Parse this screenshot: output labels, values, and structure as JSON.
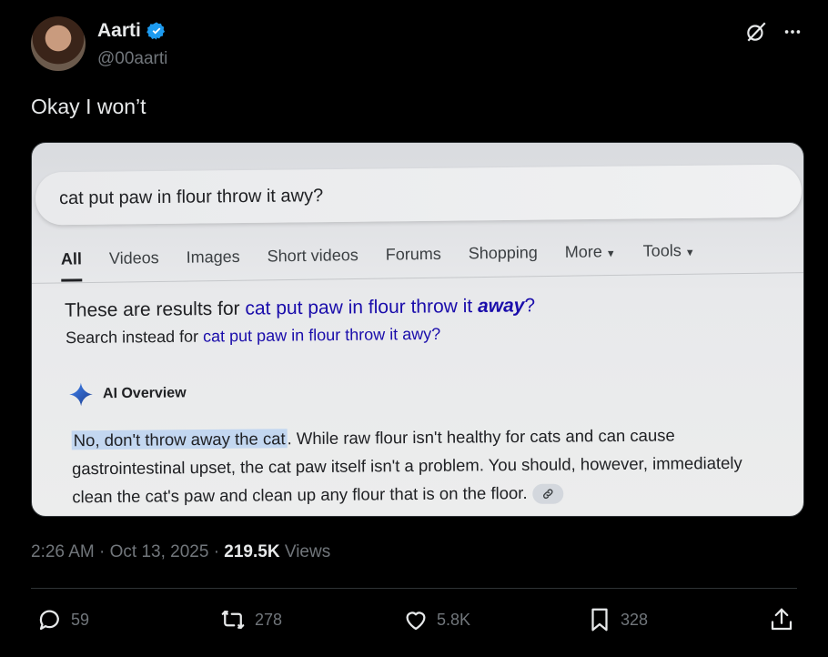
{
  "author": {
    "display_name": "Aarti",
    "handle": "@00aarti"
  },
  "icons": {
    "verified": "verified-badge-icon",
    "grok": "grok-icon",
    "more": "more-options-icon",
    "reply": "reply-icon",
    "repost": "repost-icon",
    "like": "like-icon",
    "bookmark": "bookmark-icon",
    "share": "share-icon",
    "ai_sparkle": "sparkle-icon",
    "link": "link-icon"
  },
  "colors": {
    "background": "#000000",
    "verified": "#1d9bf0",
    "secondary_text": "#71767b",
    "primary_text": "#e7e9ea",
    "google_link": "#1a0dab",
    "highlight": "#c3d7f0"
  },
  "tweet": {
    "text": "Okay I won’t"
  },
  "screenshot": {
    "search_query": "cat put paw in flour throw it awy?",
    "tabs": [
      {
        "label": "All",
        "active": true
      },
      {
        "label": "Videos"
      },
      {
        "label": "Images"
      },
      {
        "label": "Short videos"
      },
      {
        "label": "Forums"
      },
      {
        "label": "Shopping"
      },
      {
        "label": "More"
      },
      {
        "label": "Tools"
      }
    ],
    "results_prefix": "These are results for ",
    "results_query_plain": "cat put paw in flour throw it ",
    "results_query_emphasis": "away",
    "results_suffix": "?",
    "instead_prefix": "Search instead for ",
    "instead_query": "cat put paw in flour throw it awy?",
    "ai_overview_label": "AI Overview",
    "ai_highlight": "No, don't throw away the cat",
    "ai_text": ". While raw flour isn't healthy for cats and can cause gastrointestinal upset, the cat paw itself isn't a problem. You should, however, immediately clean the cat's paw and clean up any flour that is on the floor."
  },
  "meta": {
    "time": "2:26 AM",
    "date": "Oct 13, 2025",
    "separator": "·",
    "views_count": "219.5K",
    "views_label": "Views"
  },
  "stats": {
    "replies": "59",
    "reposts": "278",
    "likes": "5.8K",
    "bookmarks": "328"
  }
}
